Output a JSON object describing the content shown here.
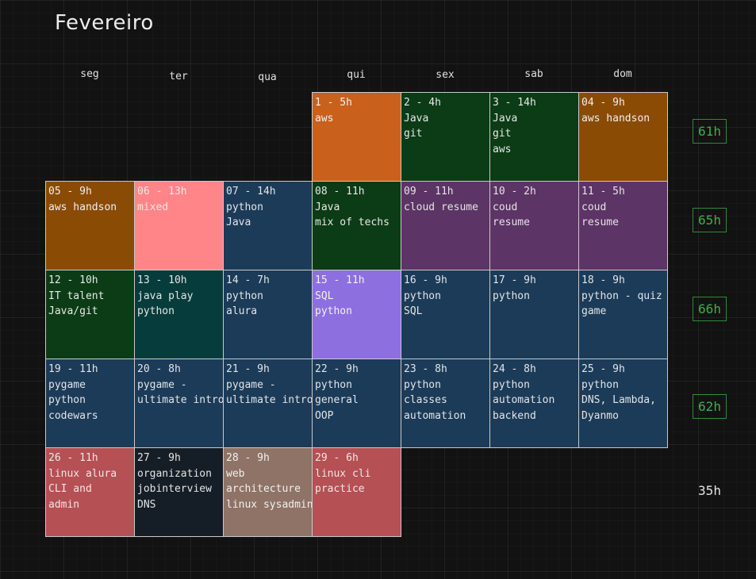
{
  "month": "Fevereiro",
  "weekdays": [
    "seg",
    "ter",
    "qua",
    "qui",
    "sex",
    "sab",
    "dom"
  ],
  "weeks": [
    {
      "total": "61h",
      "boxed": true,
      "days": [
        {
          "col": 3,
          "head": "1 - 5h",
          "lines": [
            "aws"
          ],
          "bg": "#c9601b",
          "fg": "#f2f2f2"
        },
        {
          "col": 4,
          "head": "2 - 4h",
          "lines": [
            "Java",
            "git"
          ],
          "bg": "#0b3c15",
          "fg": "#e8e8e8"
        },
        {
          "col": 5,
          "head": "3 - 14h",
          "lines": [
            "Java",
            "git",
            "aws"
          ],
          "bg": "#0b3c15",
          "fg": "#e8e8e8"
        },
        {
          "col": 6,
          "head": "04 - 9h",
          "lines": [
            "aws handson"
          ],
          "bg": "#8a4b05",
          "fg": "#f0f0f0"
        }
      ]
    },
    {
      "total": "65h",
      "boxed": true,
      "days": [
        {
          "col": 0,
          "head": "05 - 9h",
          "lines": [
            "aws handson"
          ],
          "bg": "#8a4b05",
          "fg": "#f0f0f0"
        },
        {
          "col": 1,
          "head": "06 - 13h",
          "lines": [
            "mixed"
          ],
          "bg": "#ff8589",
          "fg": "#ffe3e3"
        },
        {
          "col": 2,
          "head": "07 - 14h",
          "lines": [
            "python",
            "Java"
          ],
          "bg": "#1b3b59",
          "fg": "#e4e4e4"
        },
        {
          "col": 3,
          "head": "08 - 11h",
          "lines": [
            "Java",
            "mix of techs"
          ],
          "bg": "#0b3c15",
          "fg": "#e8e8e8"
        },
        {
          "col": 4,
          "head": "09 - 11h",
          "lines": [
            "cloud resume"
          ],
          "bg": "#5d3466",
          "fg": "#e4e4e4"
        },
        {
          "col": 5,
          "head": "10 - 2h",
          "lines": [
            "coud",
            "resume"
          ],
          "bg": "#5d3466",
          "fg": "#e4e4e4"
        },
        {
          "col": 6,
          "head": "11 - 5h",
          "lines": [
            "coud",
            "resume"
          ],
          "bg": "#5d3466",
          "fg": "#e4e4e4"
        }
      ]
    },
    {
      "total": "66h",
      "boxed": true,
      "days": [
        {
          "col": 0,
          "head": "12 - 10h",
          "lines": [
            "IT talent",
            "Java/git"
          ],
          "bg": "#0b3c15",
          "fg": "#e8e8e8"
        },
        {
          "col": 1,
          "head": "13 - 10h",
          "lines": [
            "java play",
            "python"
          ],
          "bg": "#063d3c",
          "fg": "#e4e4e4"
        },
        {
          "col": 2,
          "head": "14 - 7h",
          "lines": [
            "python",
            "alura"
          ],
          "bg": "#1b3b59",
          "fg": "#e4e4e4"
        },
        {
          "col": 3,
          "head": "15 - 11h",
          "lines": [
            "SQL",
            "python"
          ],
          "bg": "#8e6fe0",
          "fg": "#f0f0f0"
        },
        {
          "col": 4,
          "head": "16 - 9h",
          "lines": [
            "python",
            "SQL"
          ],
          "bg": "#1b3b59",
          "fg": "#e4e4e4"
        },
        {
          "col": 5,
          "head": "17 - 9h",
          "lines": [
            "python"
          ],
          "bg": "#1b3b59",
          "fg": "#e4e4e4"
        },
        {
          "col": 6,
          "head": "18 - 9h",
          "lines": [
            "python - quiz",
            "game"
          ],
          "bg": "#1b3b59",
          "fg": "#e4e4e4"
        }
      ]
    },
    {
      "total": "62h",
      "boxed": true,
      "days": [
        {
          "col": 0,
          "head": "19 - 11h",
          "lines": [
            "pygame",
            "python",
            "codewars"
          ],
          "bg": "#1b3b59",
          "fg": "#e4e4e4"
        },
        {
          "col": 1,
          "head": "20 - 8h",
          "lines": [
            "pygame -",
            "ultimate intro"
          ],
          "bg": "#1b3b59",
          "fg": "#e4e4e4"
        },
        {
          "col": 2,
          "head": "21 - 9h",
          "lines": [
            "pygame -",
            "ultimate intro"
          ],
          "bg": "#1b3b59",
          "fg": "#e4e4e4"
        },
        {
          "col": 3,
          "head": "22 - 9h",
          "lines": [
            "python",
            "general",
            "OOP"
          ],
          "bg": "#1b3b59",
          "fg": "#e4e4e4"
        },
        {
          "col": 4,
          "head": "23 - 8h",
          "lines": [
            "python",
            "classes",
            "automation"
          ],
          "bg": "#1b3b59",
          "fg": "#e4e4e4"
        },
        {
          "col": 5,
          "head": "24 - 8h",
          "lines": [
            "python",
            "automation",
            "backend"
          ],
          "bg": "#1b3b59",
          "fg": "#e4e4e4"
        },
        {
          "col": 6,
          "head": "25 - 9h",
          "lines": [
            "python",
            "DNS, Lambda,",
            "Dyanmo"
          ],
          "bg": "#1b3b59",
          "fg": "#e4e4e4"
        }
      ]
    },
    {
      "total": "35h",
      "boxed": false,
      "days": [
        {
          "col": 0,
          "head": "26 - 11h",
          "lines": [
            "linux alura",
            "CLI and",
            "admin"
          ],
          "bg": "#b55054",
          "fg": "#f0e6e6"
        },
        {
          "col": 1,
          "head": "27 - 9h",
          "lines": [
            "organization",
            "jobinterview",
            "DNS"
          ],
          "bg": "#151e27",
          "fg": "#e4e4e4"
        },
        {
          "col": 2,
          "head": "28 - 9h",
          "lines": [
            "web",
            "architecture",
            "linux sysadmin"
          ],
          "bg": "#8f7366",
          "fg": "#f0f0f0"
        },
        {
          "col": 3,
          "head": "29 - 6h",
          "lines": [
            "linux cli",
            "practice"
          ],
          "bg": "#b55054",
          "fg": "#f0e6e6"
        }
      ]
    }
  ]
}
